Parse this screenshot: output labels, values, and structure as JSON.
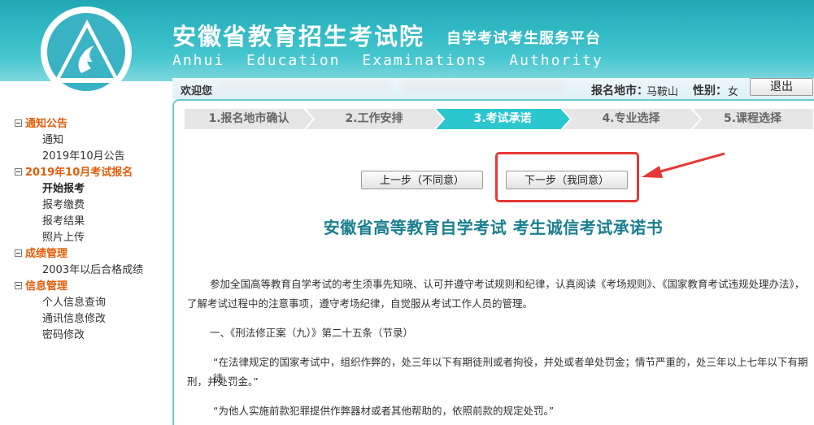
{
  "header": {
    "title": "安徽省教育招生考试院",
    "subtitle": "自学考试考生服务平台",
    "english": "Anhui Education Examinations Authority"
  },
  "userbar": {
    "welcome": "欢迎您",
    "location_label": "报名地市：",
    "location_value": "马鞍山",
    "gender_label": "性别：",
    "gender_value": "女",
    "logout": "退出"
  },
  "sidebar": {
    "groups": [
      {
        "label": "通知公告",
        "items": [
          "通知",
          "2019年10月公告"
        ]
      },
      {
        "label": "2019年10月考试报名",
        "items": [
          "开始报考",
          "报考缴费",
          "报考结果",
          "照片上传"
        ]
      },
      {
        "label": "成绩管理",
        "items": [
          "2003年以后合格成绩"
        ]
      },
      {
        "label": "信息管理",
        "items": [
          "个人信息查询",
          "通讯信息修改",
          "密码修改"
        ]
      }
    ]
  },
  "steps": [
    {
      "label": "1.报名地市确认"
    },
    {
      "label": "2.工作安排"
    },
    {
      "label": "3.考试承诺"
    },
    {
      "label": "4.专业选择"
    },
    {
      "label": "5.课程选择"
    }
  ],
  "buttons": {
    "prev": "上一步（不同意）",
    "next": "下一步（我同意）"
  },
  "document": {
    "title": "安徽省高等教育自学考试 考生诚信考试承诺书",
    "p1_line1": "参加全国高等教育自学考试的考生须事先知晓、认可并遵守考试规则和纪律，认真阅读《考场规则》、《国家教育考试违规处理办法》，",
    "p1_line2": "了解考试过程中的注意事项，遵守考场纪律，自觉服从考试工作人员的管理。",
    "section1": "一、《刑法修正案（九）》第二十五条（节录）",
    "quote1_line1": "“在法律规定的国家考试中，组织作弊的，处三年以下有期徒刑或者拘役，并处或者单处罚金；情节严重的，处三年以上七年以下有期徒",
    "quote1_line2": "刑，并处罚金。”",
    "quote2": "“为他人实施前款犯罪提供作弊器材或者其他帮助的，依照前款的规定处罚。”"
  },
  "colors": {
    "header": "#2fb8c3",
    "accent": "#1a7f8e",
    "sidebar_group": "#e35d0a",
    "step_active": "#2cc6cf",
    "highlight": "#e53935"
  }
}
